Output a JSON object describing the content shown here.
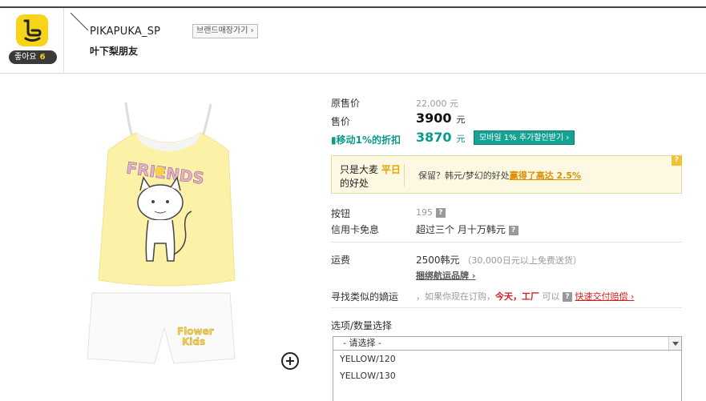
{
  "like": {
    "label": "좋아요",
    "count": "6"
  },
  "brand": {
    "name": "PIKAPUKA_SP",
    "button": "브랜드매장가기 ›",
    "shop": "叶下梨朋友"
  },
  "price": {
    "original_label": "原售价",
    "original_value": "22,000 元",
    "sale_label": "售价",
    "sale_value": "3900",
    "sale_unit": "元",
    "mobile_label": "移动1%的折扣",
    "mobile_value": "3870",
    "mobile_unit": "元",
    "mobile_button": "모바일 1% 추가할인받기 ›"
  },
  "promo": {
    "left_1": "只是大麦",
    "left_hl": "平日",
    "left_2": "的好处",
    "right_text": "保留？韩元/梦幻的好处",
    "right_link": "赢得了高达 2.5%",
    "q": "?"
  },
  "button_row": {
    "label": "按钮",
    "value": "195",
    "q": "?"
  },
  "card_row": {
    "label": "信用卡免息",
    "value": "超过三个 月十万韩元",
    "q": "?"
  },
  "shipping": {
    "label": "运费",
    "value": "2500韩元",
    "note": "（30,000日元以上免费送货）",
    "link": "捆绑航运品牌 ›"
  },
  "similar": {
    "label": "寻找类似的嫡运",
    "text": "，如果你现在订购，",
    "red": "今天，工厂",
    "text2": "可以",
    "q": "?",
    "link": "快速交付赔偿 ›"
  },
  "options": {
    "title": "选项/数量选择",
    "selected": "- 请选择 -",
    "items": [
      "YELLOW/120",
      "YELLOW/130"
    ]
  }
}
